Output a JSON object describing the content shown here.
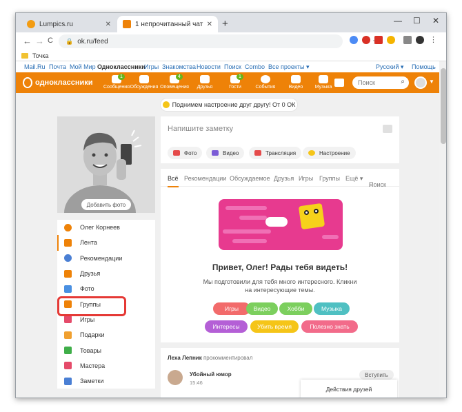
{
  "browser": {
    "tabs": [
      {
        "title": "Lumpics.ru",
        "close": "✕"
      },
      {
        "title": "1 непрочитанный чат",
        "close": "✕"
      }
    ],
    "new_tab": "+",
    "window_controls": [
      "—",
      "☐",
      "✕"
    ],
    "nav": {
      "back": "←",
      "forward": "→",
      "reload": "C"
    },
    "url": "ok.ru/feed",
    "lock": "🔒",
    "star": "☆",
    "bookmarks": [
      {
        "label": "Точка"
      }
    ]
  },
  "portal": {
    "links": [
      "Mail.Ru",
      "Почта",
      "Мой Мир",
      "Одноклассники",
      "Игры",
      "Знакомства",
      "Новости",
      "Поиск",
      "Combo",
      "Все проекты ▾"
    ],
    "language": "Русский ▾",
    "help": "Помощь"
  },
  "ok_header": {
    "logo": "одноклассники",
    "nav": [
      {
        "label": "Сообщения",
        "badge": "1"
      },
      {
        "label": "Обсуждения",
        "badge": ""
      },
      {
        "label": "Оповещения",
        "badge": "4"
      },
      {
        "label": "Друзья",
        "badge": ""
      },
      {
        "label": "Гости",
        "badge": "1"
      },
      {
        "label": "События",
        "badge": ""
      },
      {
        "label": "Видео",
        "badge": ""
      },
      {
        "label": "Музыка",
        "badge": ""
      }
    ],
    "search_placeholder": "Поиск",
    "accent": "#ee8208"
  },
  "announce": "Поднимем настроение друг другу! От 0 ОК",
  "profile": {
    "add_photo": "Добавить фото",
    "menu": [
      {
        "label": "Олег Корнеев",
        "color": "#ee8208"
      },
      {
        "label": "Лента",
        "color": "#ee8208"
      },
      {
        "label": "Рекомендации",
        "color": "#4a7fd4"
      },
      {
        "label": "Друзья",
        "color": "#ee8208"
      },
      {
        "label": "Фото",
        "color": "#4a90e2"
      },
      {
        "label": "Группы",
        "color": "#ee8208"
      },
      {
        "label": "Игры",
        "color": "#e54b6a"
      },
      {
        "label": "Подарки",
        "color": "#f0a030"
      },
      {
        "label": "Товары",
        "color": "#3fae49"
      },
      {
        "label": "Мастера",
        "color": "#e54b6a"
      },
      {
        "label": "Заметки",
        "color": "#4a7fd4"
      }
    ]
  },
  "note": {
    "placeholder": "Напишите заметку",
    "actions": [
      {
        "label": "Фото",
        "color": "#e54b4b"
      },
      {
        "label": "Видео",
        "color": "#7b5cd6"
      },
      {
        "label": "Трансляция",
        "color": "#e54b4b"
      },
      {
        "label": "Настроение",
        "color": "#f5c518"
      }
    ]
  },
  "feed": {
    "tabs": [
      "Всё",
      "Рекомендации",
      "Обсуждаемое",
      "Друзья",
      "Игры",
      "Группы",
      "Ещё ▾",
      "Поиск"
    ],
    "greeting": "Привет, Олег! Рады тебя видеть!",
    "subtitle": "Мы подготовили для тебя много интересного. Кликни на интересующие темы.",
    "categories": [
      {
        "label": "Игры",
        "color": "#f26b6b"
      },
      {
        "label": "Видео",
        "color": "#7ccf5e"
      },
      {
        "label": "Хобби",
        "color": "#7ccf5e"
      },
      {
        "label": "Музыка",
        "color": "#4fc0c2"
      },
      {
        "label": "Интересы",
        "color": "#b45fd6"
      },
      {
        "label": "Убить время",
        "color": "#f5c518"
      },
      {
        "label": "Полезно знать",
        "color": "#f26b8a"
      }
    ]
  },
  "post": {
    "author": "Леха Лепник",
    "action": "прокомментировал",
    "group": "Убойный юмор",
    "time": "15:46",
    "join": "Вступить"
  },
  "friends_actions": "Действия друзей"
}
